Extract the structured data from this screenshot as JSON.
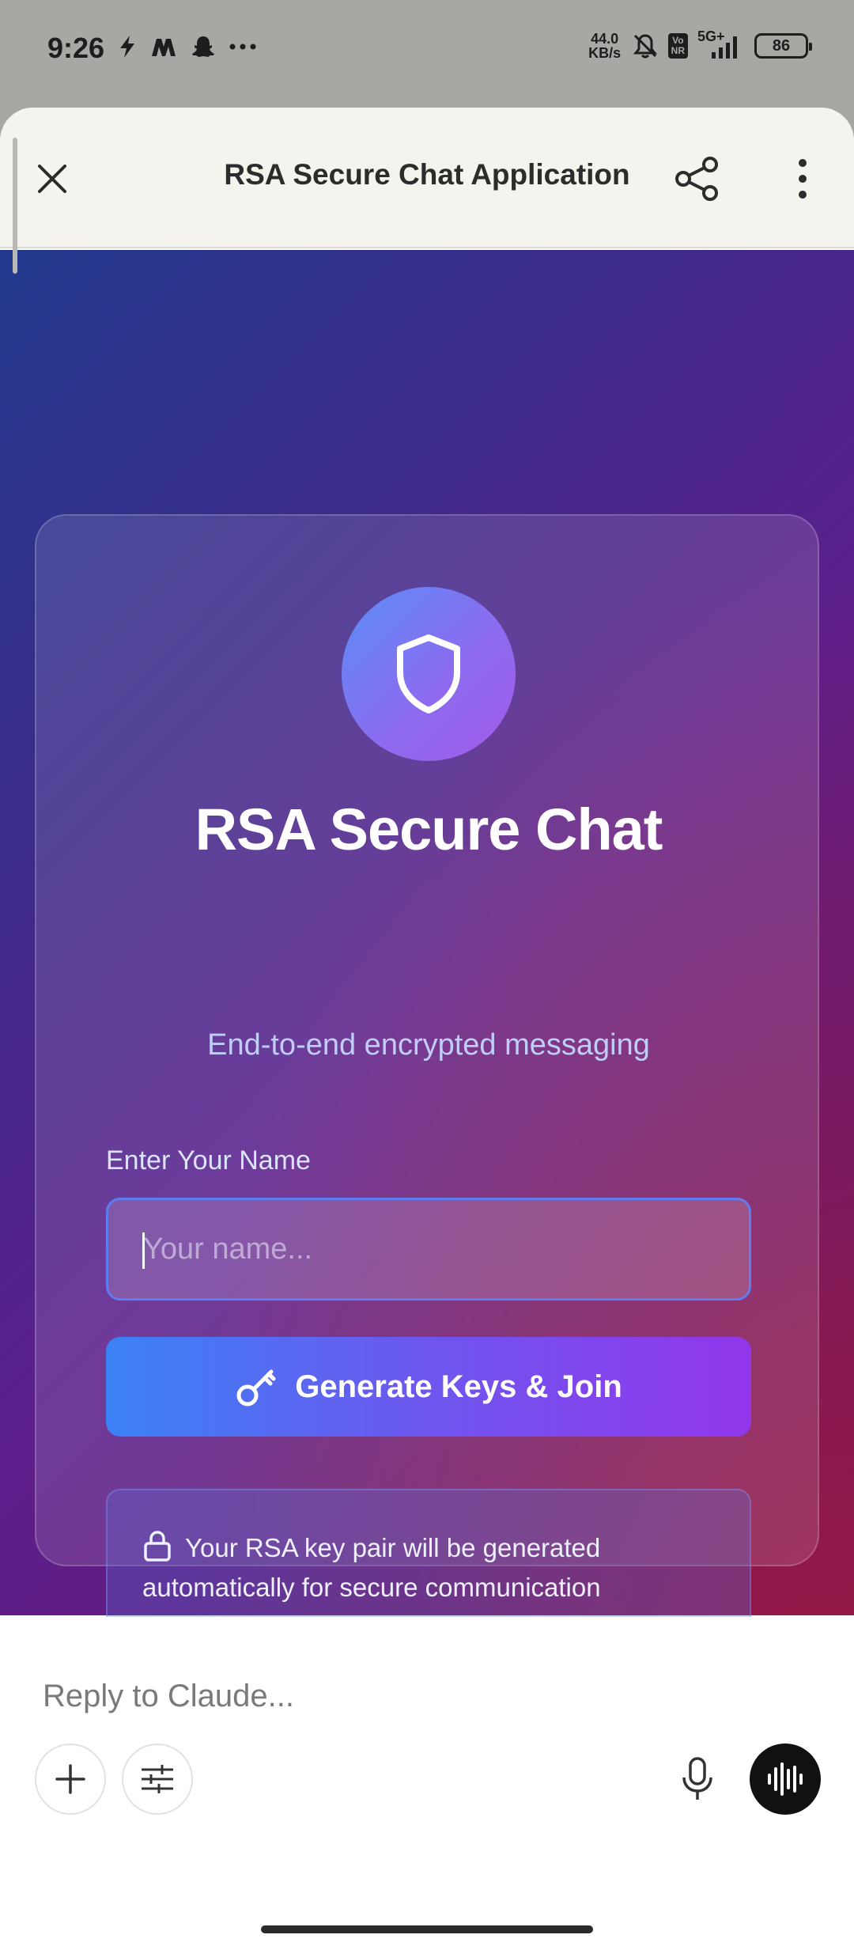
{
  "status_bar": {
    "time": "9:26",
    "left_icons": [
      "bolt-icon",
      "myntra-icon",
      "snapchat-icon",
      "more-dots-icon"
    ],
    "net_speed_value": "44.0",
    "net_speed_unit": "KB/s",
    "vonr_top": "Vo",
    "vonr_bottom": "NR",
    "network": "5G+",
    "battery": "86"
  },
  "header": {
    "title": "RSA Secure Chat Application",
    "icons": [
      "close-icon",
      "share-icon",
      "more-vertical-icon"
    ]
  },
  "card": {
    "icon": "shield-icon",
    "title": "RSA Secure Chat",
    "subtitle": "End-to-end encrypted messaging",
    "name_label": "Enter Your Name",
    "name_placeholder": "Your name...",
    "name_value": "",
    "join_button_icon": "key-icon",
    "join_button_label": "Generate Keys & Join",
    "info_icon": "lock-icon",
    "info_text": "Your RSA key pair will be generated automatically for secure communication"
  },
  "composer": {
    "placeholder": "Reply to Claude...",
    "buttons": [
      "plus-icon",
      "sliders-icon",
      "microphone-icon",
      "voice-waveform-icon"
    ]
  },
  "colors": {
    "accent_blue": "#3b82f6",
    "accent_purple": "#9236ec",
    "header_bg": "#f4f3ee"
  }
}
